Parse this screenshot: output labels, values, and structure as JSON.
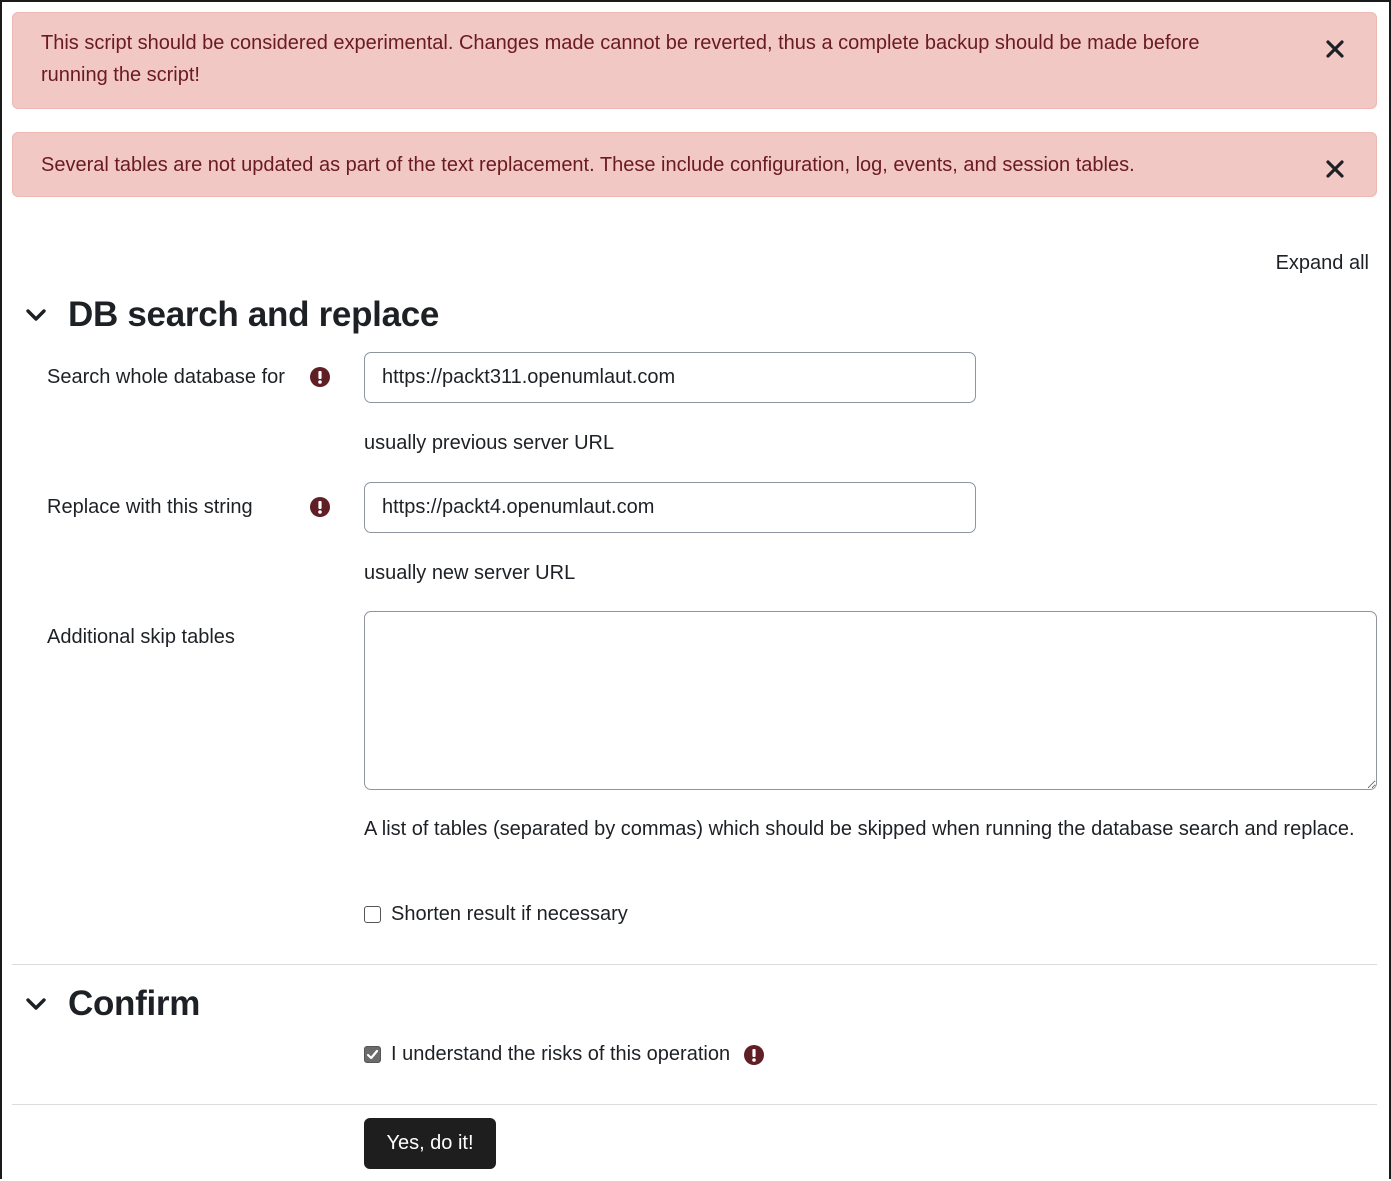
{
  "alerts": [
    {
      "text": "This script should be considered experimental. Changes made cannot be reverted, thus a complete backup should be made before running the script!",
      "close_icon": "close-icon"
    },
    {
      "text": "Several tables are not updated as part of the text replacement. These include configuration, log, events, and session tables.",
      "close_icon": "close-icon"
    }
  ],
  "expand_all": "Expand all",
  "section_search": {
    "title": "DB search and replace",
    "search": {
      "label": "Search whole database for",
      "value": "https://packt311.openumlaut.com",
      "help": "usually previous server URL"
    },
    "replace": {
      "label": "Replace with this string",
      "value": "https://packt4.openumlaut.com",
      "help": "usually new server URL"
    },
    "skip_tables": {
      "label": "Additional skip tables",
      "value": "",
      "help": "A list of tables (separated by commas) which should be skipped when running the database search and replace."
    },
    "shorten": {
      "label": "Shorten result if necessary",
      "checked": false
    }
  },
  "section_confirm": {
    "title": "Confirm",
    "understand": {
      "label": "I understand the risks of this operation",
      "checked": true
    }
  },
  "submit_label": "Yes, do it!",
  "colors": {
    "alert_bg": "#f1c8c4",
    "alert_text": "#6a1a21",
    "required_icon": "#5f1f25",
    "button_bg": "#1e1e1f"
  }
}
